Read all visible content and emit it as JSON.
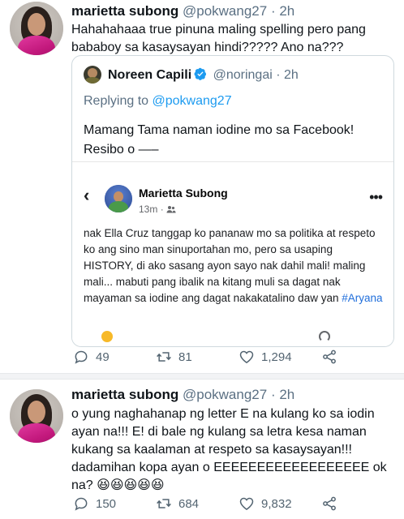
{
  "tweets": [
    {
      "name": "marietta subong",
      "handle": "@pokwang27",
      "separator": "·",
      "time": "2h",
      "text": "Hahahahaaa true pinuna maling spelling pero pang bababoy sa kasaysayan hindi????? Ano na???",
      "quoted": {
        "name": "Noreen Capili",
        "handle": "@noringai",
        "separator": "·",
        "time": "2h",
        "replying_prefix": "Replying to",
        "replying_handle": "@pokwang27",
        "text": "Mamang Tama naman iodine mo sa Facebook! Resibo o —–",
        "facebook_post": {
          "back_icon": "‹",
          "name": "Marietta Subong",
          "time": "13m",
          "audience_icon": "friends-icon",
          "more_icon": "•••",
          "text": "nak Ella Cruz tanggap ko pananaw mo sa politika at respeto ko ang sino man sinuportahan mo, pero sa usaping HISTORY, di ako sasang ayon sayo nak dahil mali! maling mali... mabuti pang ibalik na kitang muli sa dagat nak mayaman sa iodine ang dagat nakakatalino daw yan",
          "hashtag": "#Aryana"
        }
      },
      "actions": {
        "replies": "49",
        "retweets": "81",
        "likes": "1,294"
      }
    },
    {
      "name": "marietta subong",
      "handle": "@pokwang27",
      "separator": "·",
      "time": "2h",
      "text": "o yung naghahanap ng letter E na kulang ko sa iodin ayan na!!! E! di bale ng kulang sa letra kesa naman kukang sa kaalaman at respeto sa kasaysayan!!! dadamihan kopa ayan o EEEEEEEEEEEEEEEEEE ok na? 😆😆😆😆😆",
      "actions": {
        "replies": "150",
        "retweets": "684",
        "likes": "9,832"
      }
    }
  ],
  "colors": {
    "text": "#0f1419",
    "muted": "#5b7083",
    "link": "#1d9bf0",
    "border": "#cfd9de",
    "fb_hashtag": "#216fdb"
  },
  "icons": [
    "reply-icon",
    "retweet-icon",
    "like-icon",
    "share-icon",
    "verified-icon",
    "back-icon",
    "more-icon",
    "friends-icon"
  ]
}
